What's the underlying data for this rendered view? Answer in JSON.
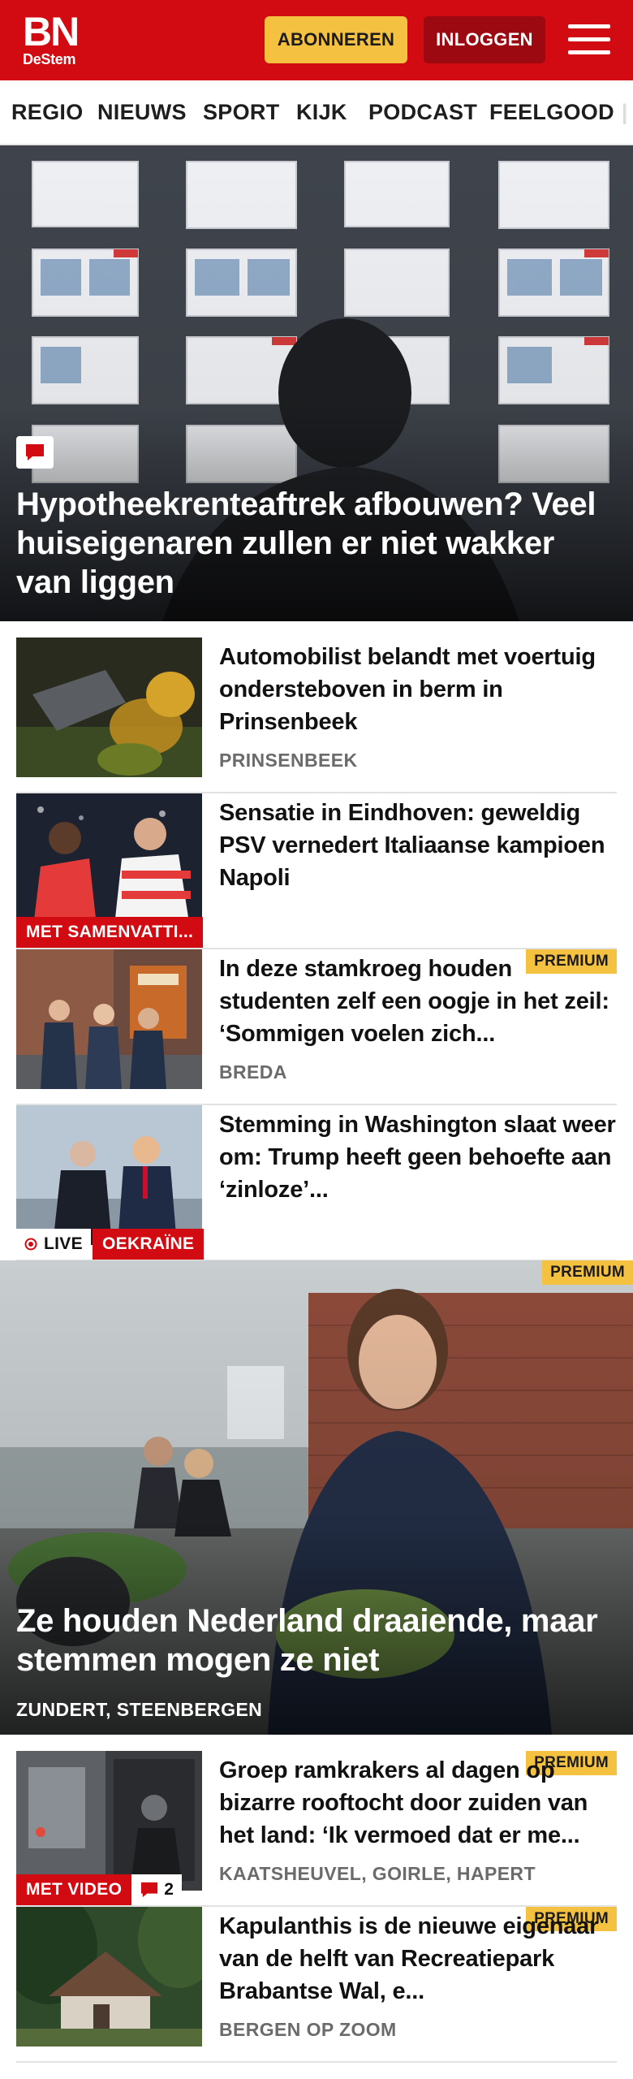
{
  "header": {
    "logo_top": "BN",
    "logo_bottom": "DeStem",
    "subscribe_label": "ABONNEREN",
    "login_label": "INLOGGEN",
    "menu_icon": "hamburger-menu-icon",
    "brand_red": "#d20a11",
    "accent_yellow": "#f5c140"
  },
  "nav": {
    "items": [
      "REGIO",
      "NIEUWS",
      "SPORT",
      "KIJK",
      "PODCAST",
      "FEELGOOD"
    ]
  },
  "hero": {
    "title": "Hypotheekrenteaftrek afbouwen? Veel huiseigenaren zullen er niet wakker van liggen",
    "badge_icon": "comment-icon"
  },
  "articles": [
    {
      "title": "Automobilist belandt met voertuig ondersteboven in berm in Prinsenbeek",
      "location": "PRINSENBEEK"
    },
    {
      "title": "Sensatie in Eindhoven: geweldig PSV vernedert Italiaanse kampioen Napoli",
      "label": "MET SAMENVATTI..."
    },
    {
      "title": "In deze stamkroeg houden studenten zelf een oogje in het zeil: ‘Sommigen voelen zich...",
      "location": "BREDA",
      "premium": "PREMIUM"
    },
    {
      "title": "Stemming in Washington slaat weer om: Trump heeft geen behoefte aan ‘zinloze’...",
      "live": "LIVE",
      "label": "OEKRAÏNE"
    }
  ],
  "feature": {
    "premium": "PREMIUM",
    "title": "Ze houden Nederland draaiende, maar stemmen mogen ze niet",
    "location": "ZUNDERT, STEENBERGEN"
  },
  "articles2": [
    {
      "title": "Groep ramkrakers al dagen op bizarre rooftocht door zuiden van het land: ‘Ik vermoed dat er me...",
      "location": "KAATSHEUVEL, GOIRLE, HAPERT",
      "premium": "PREMIUM",
      "label": "MET VIDEO",
      "comments": "2"
    },
    {
      "title": "Kapulanthis is de nieuwe eigenaar van de helft van Recreatiepark Brabantse Wal, e...",
      "location": "BERGEN OP ZOOM",
      "premium": "PREMIUM"
    }
  ]
}
